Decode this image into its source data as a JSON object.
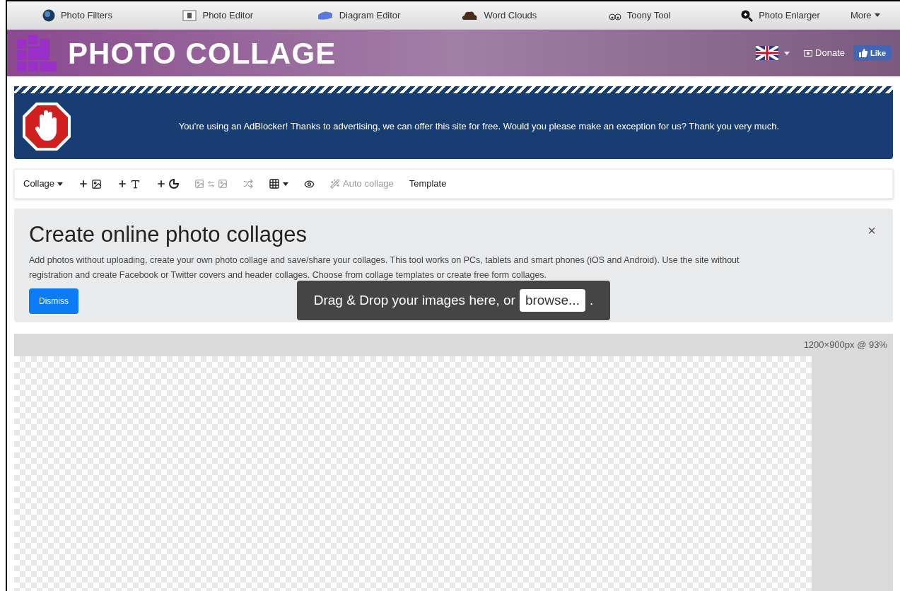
{
  "nav": {
    "items": [
      {
        "label": "Photo Filters",
        "kind": "globe"
      },
      {
        "label": "Photo Editor",
        "kind": "editor"
      },
      {
        "label": "Diagram Editor",
        "kind": "diagram"
      },
      {
        "label": "Word Clouds",
        "kind": "cloud"
      },
      {
        "label": "Toony Tool",
        "kind": "toony"
      },
      {
        "label": "Photo Enlarger",
        "kind": "zoom"
      }
    ],
    "more": "More"
  },
  "banner": {
    "title": "PHOTO COLLAGE",
    "donate": "Donate",
    "like": "Like"
  },
  "adblock": {
    "message": "You're using an AdBlocker! Thanks to advertising, we can offer this site for free. Would you please make an exception for us? Thank you very much."
  },
  "toolbar": [
    {
      "kind": "menu",
      "label": "Collage",
      "disabled": false
    },
    {
      "kind": "add-image",
      "disabled": false
    },
    {
      "kind": "add-text",
      "disabled": false
    },
    {
      "kind": "add-shape",
      "disabled": false
    },
    {
      "kind": "swap",
      "disabled": true
    },
    {
      "kind": "shuffle",
      "disabled": true
    },
    {
      "kind": "grid",
      "disabled": false
    },
    {
      "kind": "preview",
      "disabled": false
    },
    {
      "kind": "auto",
      "label": "Auto collage",
      "disabled": true
    },
    {
      "kind": "text",
      "label": "Template",
      "disabled": false
    }
  ],
  "intro": {
    "title": "Create online photo collages",
    "text": "Add photos without uploading, create your own photo collage and save/share your collages. This tool works on PCs, tablets and smart phones (iOS and Android). Use the site without registration and create Facebook or Twitter covers and header collages. Choose from collage templates or create free form collages.",
    "close": "×",
    "dismiss": "Dismiss"
  },
  "drop": {
    "text": "Drag & Drop your images here, or",
    "browse": "browse...",
    "end": "."
  },
  "canvas": {
    "size": "1200×900px @ 93%"
  }
}
